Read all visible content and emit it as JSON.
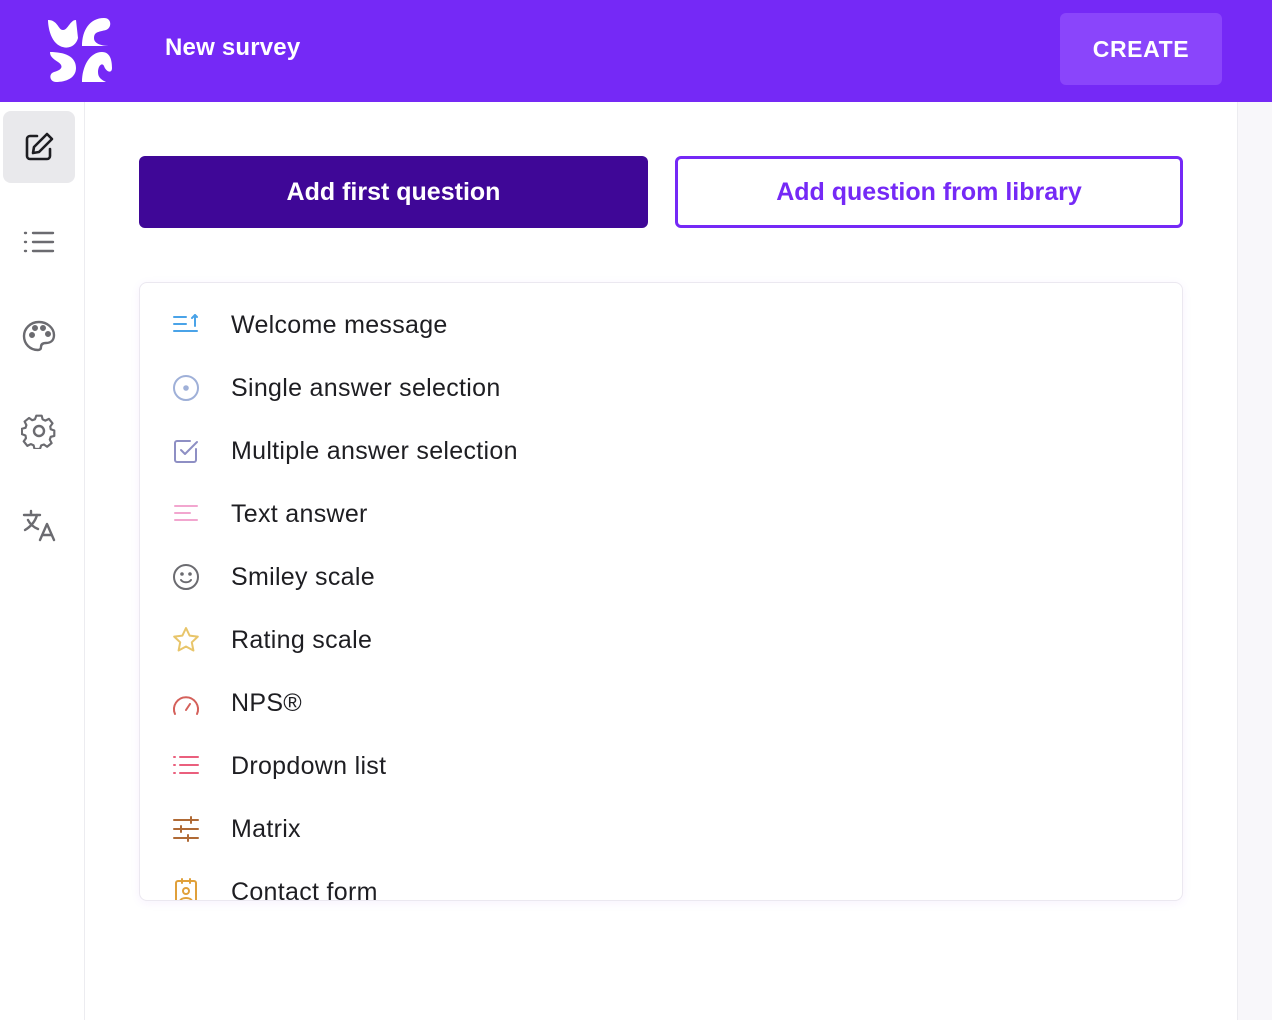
{
  "header": {
    "title": "New survey",
    "create_label": "CREATE",
    "logo_icon": "survey-logo-icon"
  },
  "sidebar": {
    "items": [
      {
        "icon": "edit-icon",
        "active": true
      },
      {
        "icon": "list-icon",
        "active": false
      },
      {
        "icon": "palette-icon",
        "active": false
      },
      {
        "icon": "gear-icon",
        "active": false
      },
      {
        "icon": "translate-icon",
        "active": false
      }
    ]
  },
  "actions": {
    "add_first_label": "Add first question",
    "add_library_label": "Add question from library"
  },
  "question_types": [
    {
      "label": "Welcome message",
      "icon": "welcome-icon",
      "color": "#4aa3e8"
    },
    {
      "label": "Single answer selection",
      "icon": "radio-icon",
      "color": "#9fb0d8"
    },
    {
      "label": "Multiple answer selection",
      "icon": "checkbox-icon",
      "color": "#8e8fc4"
    },
    {
      "label": "Text answer",
      "icon": "text-icon",
      "color": "#f2a6cf"
    },
    {
      "label": "Smiley scale",
      "icon": "smiley-icon",
      "color": "#6b6b70"
    },
    {
      "label": "Rating scale",
      "icon": "star-icon",
      "color": "#e8c56a"
    },
    {
      "label": "NPS®",
      "icon": "gauge-icon",
      "color": "#d4605a"
    },
    {
      "label": "Dropdown list",
      "icon": "dropdown-list-icon",
      "color": "#ea5f7d"
    },
    {
      "label": "Matrix",
      "icon": "matrix-icon",
      "color": "#b06a35"
    },
    {
      "label": "Contact form",
      "icon": "contact-icon",
      "color": "#e0a03a"
    }
  ],
  "colors": {
    "brand": "#7529f6",
    "primary_dark": "#3f0797"
  }
}
